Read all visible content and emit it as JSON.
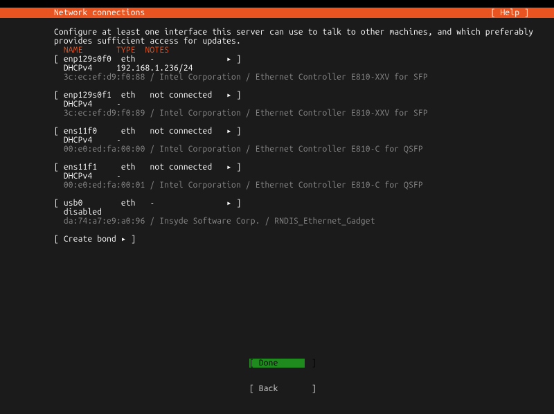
{
  "header": {
    "title": "Network connections",
    "help_label": "[ Help ]"
  },
  "intro": {
    "line1": "Configure at least one interface this server can use to talk to other machines, and which preferably",
    "line2": "provides sufficient access for updates."
  },
  "columns": {
    "name": "NAME",
    "type": "TYPE",
    "notes": "NOTES"
  },
  "glyphs": {
    "arrow": "▸",
    "lb": "[",
    "rb": "]"
  },
  "interfaces": [
    {
      "name": "enp129s0f0",
      "type": "eth",
      "notes": "-",
      "status_label": "DHCPv4",
      "status_value": "192.168.1.236/24",
      "hw": "3c:ec:ef:d9:f0:88 / Intel Corporation / Ethernet Controller E810-XXV for SFP"
    },
    {
      "name": "enp129s0f1",
      "type": "eth",
      "notes": "not connected",
      "status_label": "DHCPv4",
      "status_value": "-",
      "hw": "3c:ec:ef:d9:f0:89 / Intel Corporation / Ethernet Controller E810-XXV for SFP"
    },
    {
      "name": "ens11f0",
      "type": "eth",
      "notes": "not connected",
      "status_label": "DHCPv4",
      "status_value": "-",
      "hw": "00:e0:ed:fa:00:00 / Intel Corporation / Ethernet Controller E810-C for QSFP"
    },
    {
      "name": "ens11f1",
      "type": "eth",
      "notes": "not connected",
      "status_label": "DHCPv4",
      "status_value": "-",
      "hw": "00:e0:ed:fa:00:01 / Intel Corporation / Ethernet Controller E810-C for QSFP"
    },
    {
      "name": "usb0",
      "type": "eth",
      "notes": "-",
      "status_label": "disabled",
      "status_value": "",
      "hw": "da:74:a7:e9:a0:96 / Insyde Software Corp. / RNDIS_Ethernet_Gadget"
    }
  ],
  "create_bond_label": "Create bond",
  "footer": {
    "done": "Done",
    "back": "Back"
  }
}
